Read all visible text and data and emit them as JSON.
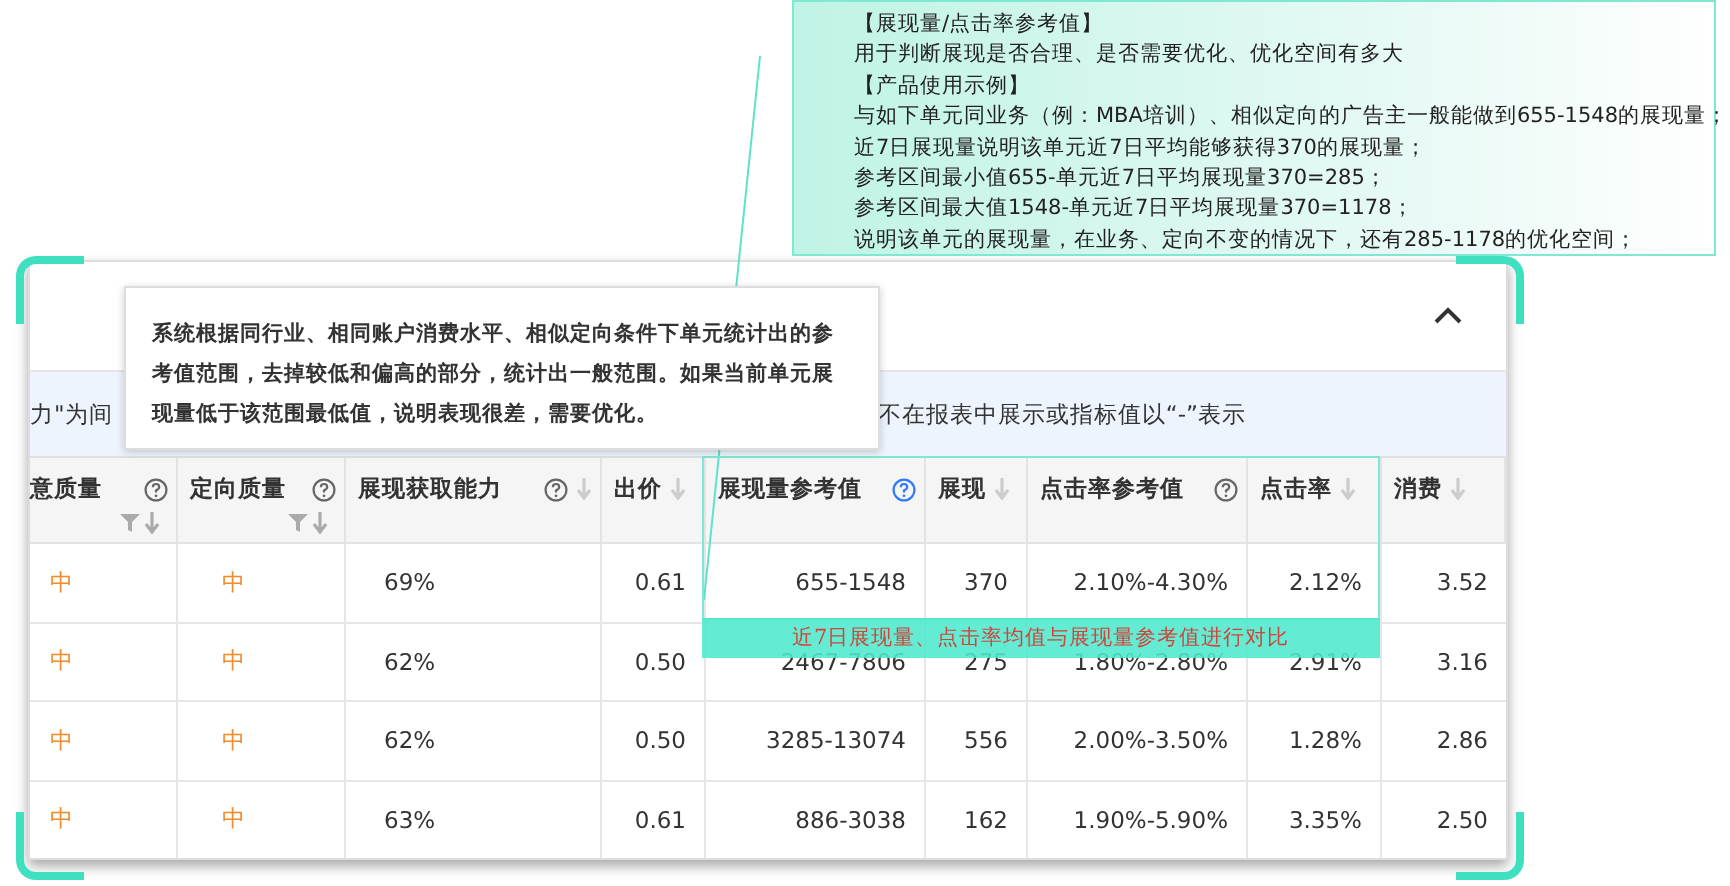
{
  "callout": {
    "lines": [
      "【展现量/点击率参考值】",
      "用于判断展现是否合理、是否需要优化、优化空间有多大",
      "【产品使用示例】",
      "与如下单元同业务（例：MBA培训）、相似定向的广告主一般能做到655-1548的展现量；",
      "近7日展现量说明该单元近7日平均能够获得370的展现量；",
      "参考区间最小值655-单元近7日平均展现量370=285；",
      "参考区间最大值1548-单元近7日平均展现量370=1178；",
      "说明该单元的展现量，在业务、定向不变的情况下，还有285-1178的优化空间；"
    ]
  },
  "panel": {
    "expanded": true
  },
  "notice": {
    "left": "力\"为间",
    "right": "不在报表中展示或指标值以“-”表示"
  },
  "tooltip": {
    "text": "系统根据同行业、相同账户消费水平、相似定向条件下单元统计出的参考值范围，去掉较低和偏高的部分，统计出一般范围。如果当前单元展现量低于该范围最低值，说明表现很差，需要优化。"
  },
  "table": {
    "columns": [
      {
        "label": "意质量",
        "kind": "grade",
        "help": true,
        "help_highlighted": false,
        "filter": true,
        "sort": true
      },
      {
        "label": "定向质量",
        "kind": "grade",
        "help": true,
        "help_highlighted": false,
        "filter": true,
        "sort": true
      },
      {
        "label": "展现获取能力",
        "kind": "percent",
        "help": true,
        "help_highlighted": false,
        "filter": false,
        "sort": true
      },
      {
        "label": "出价",
        "kind": "number",
        "help": false,
        "filter": false,
        "sort": true
      },
      {
        "label": "展现量参考值",
        "kind": "number",
        "help": true,
        "help_highlighted": true,
        "filter": false,
        "sort": false
      },
      {
        "label": "展现",
        "kind": "number",
        "help": false,
        "filter": false,
        "sort": true
      },
      {
        "label": "点击率参考值",
        "kind": "number",
        "help": true,
        "help_highlighted": false,
        "filter": false,
        "sort": false
      },
      {
        "label": "点击率",
        "kind": "number",
        "help": false,
        "filter": false,
        "sort": true
      },
      {
        "label": "消费",
        "kind": "number",
        "help": false,
        "filter": false,
        "sort": true
      }
    ],
    "rows": [
      [
        "中",
        "中",
        "69%",
        "0.61",
        "655-1548",
        "370",
        "2.10%-4.30%",
        "2.12%",
        "3.52"
      ],
      [
        "中",
        "中",
        "62%",
        "0.50",
        "2467-7806",
        "275",
        "1.80%-2.80%",
        "2.91%",
        "3.16"
      ],
      [
        "中",
        "中",
        "62%",
        "0.50",
        "3285-13074",
        "556",
        "2.00%-3.50%",
        "1.28%",
        "2.86"
      ],
      [
        "中",
        "中",
        "63%",
        "0.61",
        "886-3038",
        "162",
        "1.90%-5.90%",
        "3.35%",
        "2.50"
      ]
    ]
  },
  "highlight": {
    "label": "近7日展现量、点击率均值与展现量参考值进行对比"
  }
}
